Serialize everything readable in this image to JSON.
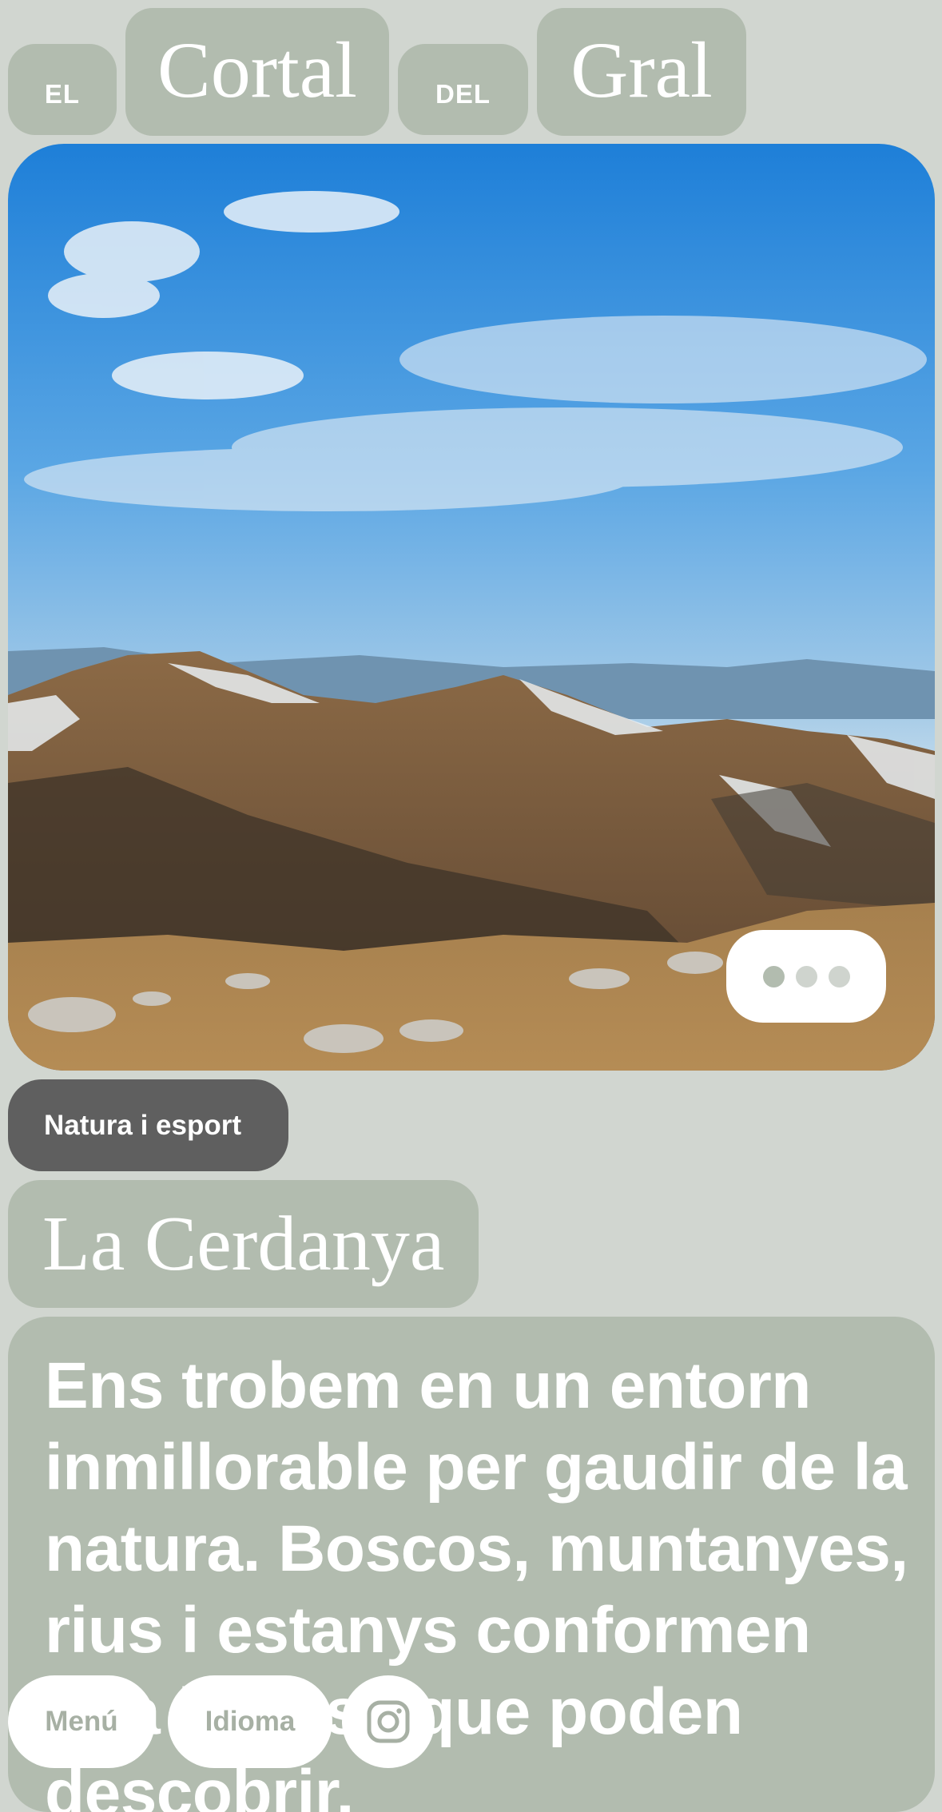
{
  "header": {
    "words": {
      "el": "EL",
      "cortal": "Cortal",
      "del": "DEL",
      "gral": "Gral"
    }
  },
  "hero": {
    "image_description_icon": "mountain-landscape-photo",
    "more_button_icon": "three-dots-icon"
  },
  "category": {
    "label": "Natura i esport"
  },
  "section": {
    "title": "La Cerdanya",
    "description": "Ens trobem en un entorn inmillorable per gaudir de la natura. Boscos, muntanyes, rius i estanys conformen una bellesa que poden descobrir."
  },
  "bottom_nav": {
    "menu_label": "Menú",
    "language_label": "Idioma",
    "instagram_icon": "instagram-icon"
  },
  "colors": {
    "background": "#d1d6d0",
    "sage": "#b2bcaf",
    "tag_dark": "#5f5f5f",
    "white": "#ffffff"
  }
}
